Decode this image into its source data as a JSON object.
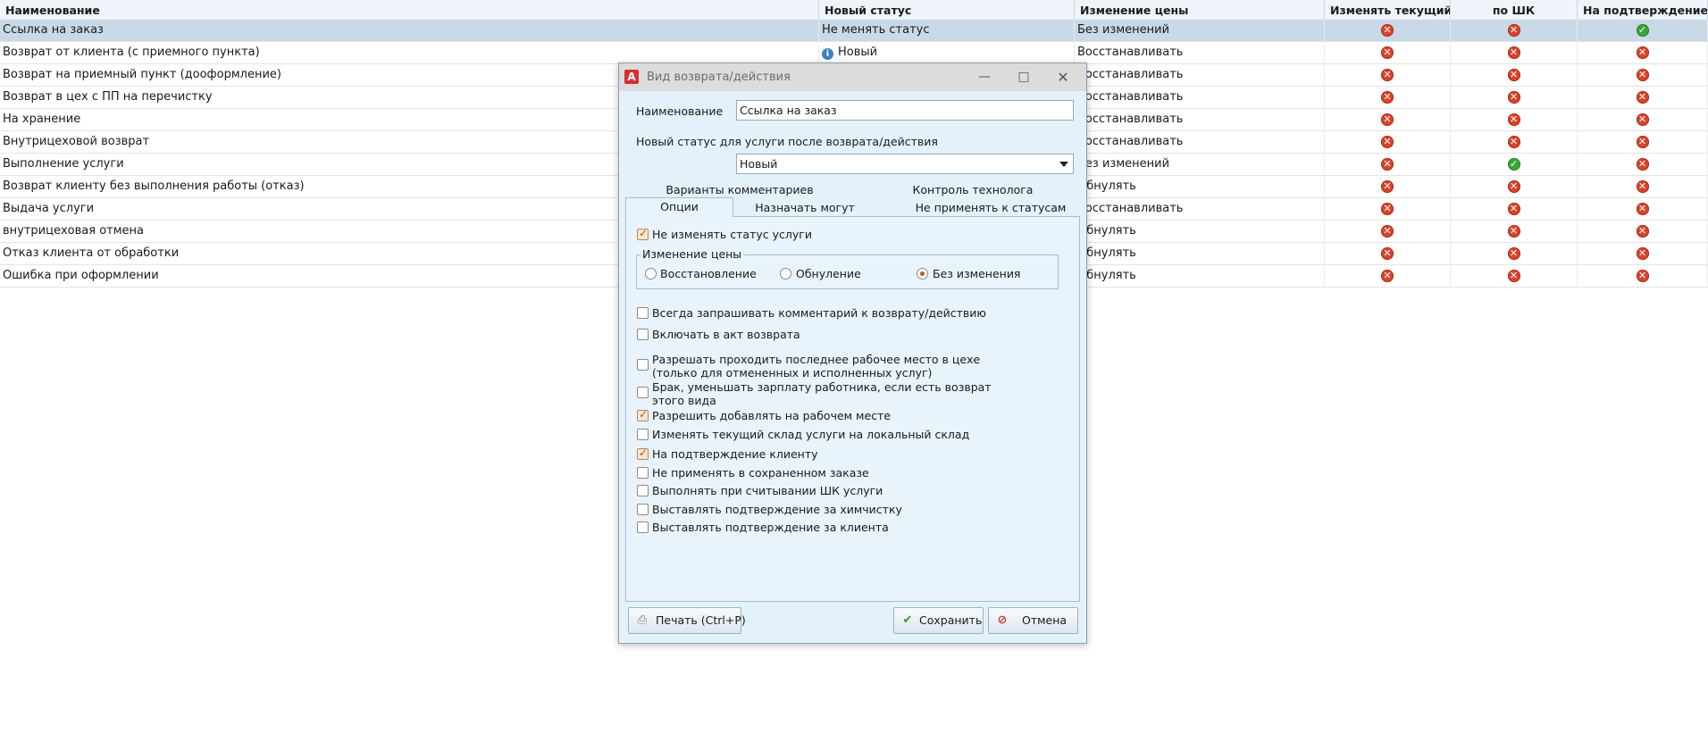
{
  "grid": {
    "columns": [
      "Наименование",
      "Новый статус",
      "Изменение цены",
      "Изменять текущий с...",
      "по ШК",
      "На подтверждение к..."
    ],
    "rows": [
      {
        "name": "Ссылка на заказ",
        "status": "Не менять статус",
        "status_icon": false,
        "price": "Без изменений",
        "flags": [
          "no",
          "no",
          "yes"
        ]
      },
      {
        "name": "Возврат от клиента (с приемного пункта)",
        "status": "Новый",
        "status_icon": true,
        "price": "Восстанавливать",
        "flags": [
          "no",
          "no",
          "no"
        ]
      },
      {
        "name": "Возврат на приемный пункт (дооформление)",
        "status": "",
        "status_icon": false,
        "price": "Восстанавливать",
        "flags": [
          "no",
          "no",
          "no"
        ]
      },
      {
        "name": "Возврат в цех с ПП на перечистку",
        "status": "",
        "status_icon": false,
        "price": "Восстанавливать",
        "flags": [
          "no",
          "no",
          "no"
        ]
      },
      {
        "name": "На хранение",
        "status": "",
        "status_icon": false,
        "price": "Восстанавливать",
        "flags": [
          "no",
          "no",
          "no"
        ]
      },
      {
        "name": "Внутрицеховой возврат",
        "status": "",
        "status_icon": false,
        "price": "Восстанавливать",
        "flags": [
          "no",
          "no",
          "no"
        ]
      },
      {
        "name": "Выполнение услуги",
        "status": "",
        "status_icon": false,
        "price": "Без изменений",
        "flags": [
          "no",
          "yes",
          "no"
        ]
      },
      {
        "name": "Возврат клиенту без выполнения работы (отказ)",
        "status": "",
        "status_icon": false,
        "price": "Обнулять",
        "flags": [
          "no",
          "no",
          "no"
        ]
      },
      {
        "name": "Выдача услуги",
        "status": "",
        "status_icon": false,
        "price": "Восстанавливать",
        "flags": [
          "no",
          "no",
          "no"
        ]
      },
      {
        "name": "внутрицеховая отмена",
        "status": "",
        "status_icon": false,
        "price": "Обнулять",
        "flags": [
          "no",
          "no",
          "no"
        ]
      },
      {
        "name": "Отказ клиента от обработки",
        "status": "",
        "status_icon": false,
        "price": "Обнулять",
        "flags": [
          "no",
          "no",
          "no"
        ]
      },
      {
        "name": "Ошибка при оформлении",
        "status": "",
        "status_icon": false,
        "price": "Обнулять",
        "flags": [
          "no",
          "no",
          "no"
        ]
      }
    ]
  },
  "dialog": {
    "title": "Вид возврата/действия",
    "name_label": "Наименование",
    "name_value": "Ссылка на заказ",
    "status_label": "Новый статус для услуги после возврата/действия",
    "status_value": "Новый",
    "tabs_top": [
      "Варианты комментариев",
      "Контроль технолога"
    ],
    "tabs_bottom": [
      "Опции",
      "Назначать могут",
      "Не применять к статусам"
    ],
    "options": {
      "dont_change_status": {
        "label": "Не изменять статус услуги",
        "checked": true
      },
      "price_group": {
        "title": "Изменение цены",
        "radios": [
          {
            "label": "Восстановление",
            "selected": false
          },
          {
            "label": "Обнуление",
            "selected": false
          },
          {
            "label": "Без изменения",
            "selected": true
          }
        ]
      },
      "checks": [
        {
          "label": "Всегда запрашивать комментарий к возврату/действию",
          "checked": false
        },
        {
          "label": "Включать в акт возврата",
          "checked": false
        },
        {
          "label": "Разрешать проходить последнее рабочее место в цехе",
          "label2": "(только для отмененных и исполненных услуг)",
          "checked": false
        },
        {
          "label": "Брак, уменьшать зарплату работника, если есть возврат",
          "label2": "этого вида",
          "checked": false
        },
        {
          "label": "Разрешить добавлять на рабочем месте",
          "checked": true
        },
        {
          "label": "Изменять текущий склад услуги на локальный склад",
          "checked": false
        },
        {
          "label": "На подтверждение клиенту",
          "checked": true
        },
        {
          "label": "Не применять в сохраненном заказе",
          "checked": false
        },
        {
          "label": "Выполнять при считывании ШК услуги",
          "checked": false
        },
        {
          "label": "Выставлять подтверждение за химчистку",
          "checked": false
        },
        {
          "label": "Выставлять подтверждение за клиента",
          "checked": false
        }
      ]
    },
    "buttons": {
      "print": "Печать (Ctrl+P)",
      "save": "Сохранить",
      "cancel": "Отмена"
    }
  },
  "colors": {
    "error": "#d8442b",
    "ok": "#3aa63a",
    "selection": "#c9d9e7",
    "dialog_bg": "#e3f1fa"
  }
}
